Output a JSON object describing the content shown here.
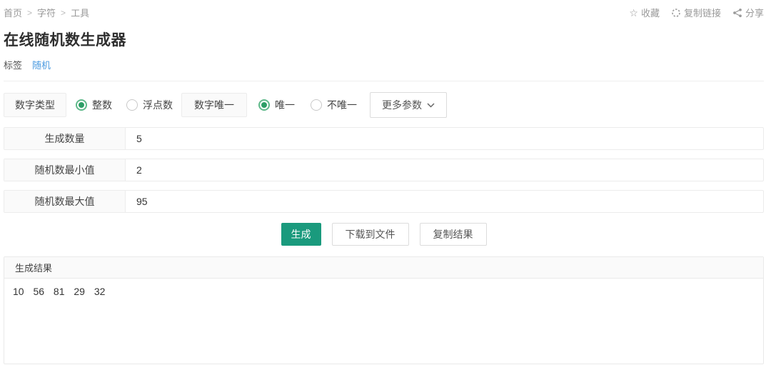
{
  "breadcrumb": {
    "items": [
      "首页",
      "字符",
      "工具"
    ],
    "separator": ">"
  },
  "header_actions": {
    "favorite": "收藏",
    "copy_link": "复制链接",
    "share": "分享"
  },
  "page": {
    "title": "在线随机数生成器"
  },
  "tags": {
    "label": "标签",
    "items": [
      "随机"
    ]
  },
  "options": {
    "number_type": {
      "label": "数字类型",
      "choices": [
        {
          "label": "整数",
          "selected": true
        },
        {
          "label": "浮点数",
          "selected": false
        }
      ]
    },
    "uniqueness": {
      "label": "数字唯一",
      "choices": [
        {
          "label": "唯一",
          "selected": true
        },
        {
          "label": "不唯一",
          "selected": false
        }
      ]
    },
    "more_params_label": "更多参数"
  },
  "fields": [
    {
      "label": "生成数量",
      "value": "5"
    },
    {
      "label": "随机数最小值",
      "value": "2"
    },
    {
      "label": "随机数最大值",
      "value": "95"
    }
  ],
  "buttons": {
    "generate": "生成",
    "download": "下载到文件",
    "copy_result": "复制结果"
  },
  "result": {
    "header": "生成结果",
    "values": [
      10,
      56,
      81,
      29,
      32
    ],
    "text": "10 56 81 29 32"
  },
  "colors": {
    "accent_green": "#1a9a7d",
    "radio_green": "#2d9e66",
    "link_blue": "#4a9ae0"
  }
}
